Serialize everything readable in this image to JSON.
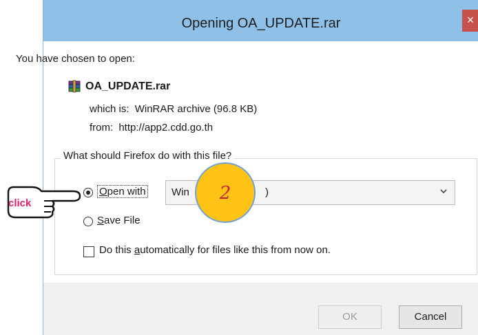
{
  "dialog": {
    "title": "Opening OA_UPDATE.rar",
    "close_glyph": "×",
    "intro": "You have chosen to open:",
    "file_name": "OA_UPDATE.rar",
    "file_icon": "winrar-archive-icon",
    "which_is_label": "which is:",
    "which_is_value": "WinRAR archive (96.8 KB)",
    "from_label": "from:",
    "from_value": "http://app2.cdd.go.th",
    "group_title": "What should Firefox do with this file?",
    "open_with": {
      "label_u": "O",
      "label_rest": "pen with",
      "selected": true,
      "select_value_left": "Win",
      "select_value_right": ")"
    },
    "save_file": {
      "label_u": "S",
      "label_rest": "ave File",
      "selected": false
    },
    "auto_checkbox": {
      "label_pre": "Do this ",
      "label_u": "a",
      "label_rest": "utomatically for files like this from now on.",
      "checked": false
    },
    "buttons": {
      "ok": "OK",
      "cancel": "Cancel"
    }
  },
  "annotations": {
    "step_number": "2",
    "click_label": "click",
    "step_color": "#ffc20e",
    "click_color": "#e0206c"
  }
}
